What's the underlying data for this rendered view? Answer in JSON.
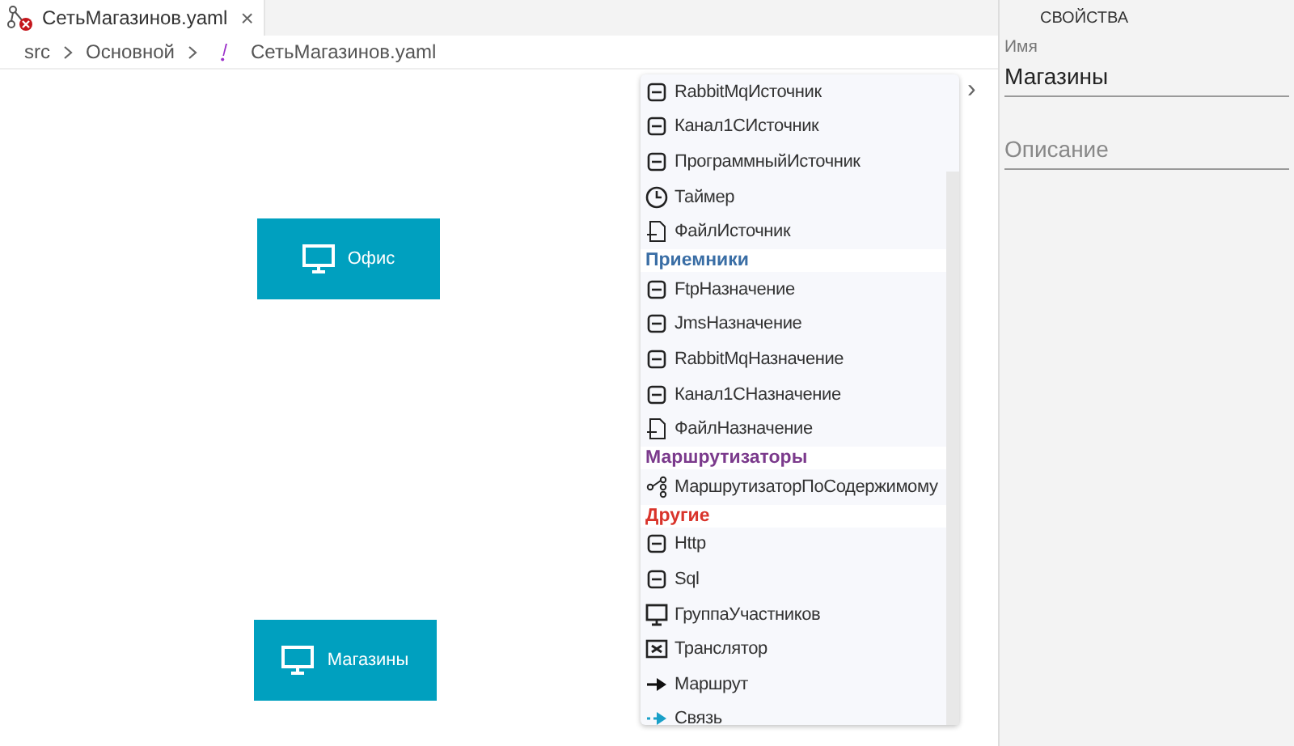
{
  "tab": {
    "title": "СетьМагазинов.yaml",
    "close": "×"
  },
  "breadcrumb": [
    "src",
    "Основной",
    "СетьМагазинов.yaml"
  ],
  "nodes": [
    {
      "label": "Офис"
    },
    {
      "label": "Магазины"
    }
  ],
  "palette": {
    "expand": "›",
    "entries": [
      {
        "kind": "item",
        "label": "RabbitMqИсточник"
      },
      {
        "kind": "item",
        "label": "Канал1СИсточник"
      },
      {
        "kind": "item",
        "label": "ПрограммныйИсточник"
      },
      {
        "kind": "item",
        "label": "Таймер"
      },
      {
        "kind": "item",
        "label": "ФайлИсточник"
      },
      {
        "kind": "header",
        "label": "Приемники",
        "color": "#3a6ea5"
      },
      {
        "kind": "item",
        "label": "FtpНазначение"
      },
      {
        "kind": "item",
        "label": "JmsНазначение"
      },
      {
        "kind": "item",
        "label": "RabbitMqНазначение"
      },
      {
        "kind": "item",
        "label": "Канал1СНазначение"
      },
      {
        "kind": "item",
        "label": "ФайлНазначение"
      },
      {
        "kind": "header",
        "label": "Маршрутизаторы",
        "color": "#7b3a8c"
      },
      {
        "kind": "item",
        "label": "МаршрутизаторПоСодержимому"
      },
      {
        "kind": "header",
        "label": "Другие",
        "color": "#d9342b"
      },
      {
        "kind": "item",
        "label": "Http"
      },
      {
        "kind": "item",
        "label": "Sql"
      },
      {
        "kind": "item",
        "label": "ГруппаУчастников"
      },
      {
        "kind": "item",
        "label": "Транслятор"
      },
      {
        "kind": "item",
        "label": "Маршрут"
      },
      {
        "kind": "item",
        "label": "Связь"
      }
    ]
  },
  "properties": {
    "title": "СВОЙСТВА",
    "fields": [
      {
        "label": "Имя",
        "value": "Магазины"
      },
      {
        "placeholder": "Описание"
      }
    ]
  }
}
